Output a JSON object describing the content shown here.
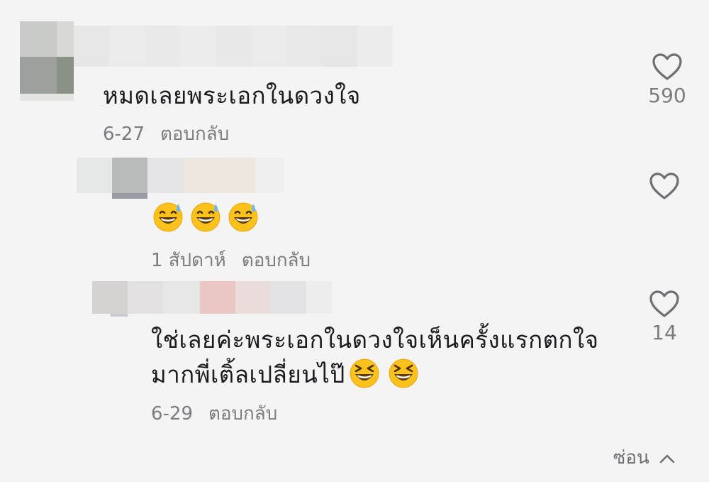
{
  "comments": [
    {
      "text": "หมดเลยพระเอกในดวงใจ",
      "date": "6-27",
      "reply_label": "ตอบกลับ",
      "likes": "590",
      "emojis": []
    },
    {
      "text": "",
      "date": "1 สัปดาห์",
      "reply_label": "ตอบกลับ",
      "likes": "",
      "emojis": [
        "sweat-smile-emoji",
        "sweat-smile-emoji",
        "sweat-smile-emoji"
      ]
    },
    {
      "line1": "ใช่เลยค่ะพระเอกในดวงใจเห็นครั้งแรกตกใจ",
      "line2": "มากพี่เติ้ลเปลี่ยนไป๊",
      "date": "6-29",
      "reply_label": "ตอบกลับ",
      "likes": "14",
      "emojis": [
        "grinning-squint-emoji",
        "grinning-squint-emoji"
      ]
    }
  ],
  "footer": {
    "hide_label": "ซ่อน",
    "icon": "chevron-up-icon"
  },
  "colors": {
    "background": "#f4f4f4",
    "text": "#1b1b1f",
    "meta": "#7c7c80",
    "emoji_face": "#fcc21b"
  }
}
